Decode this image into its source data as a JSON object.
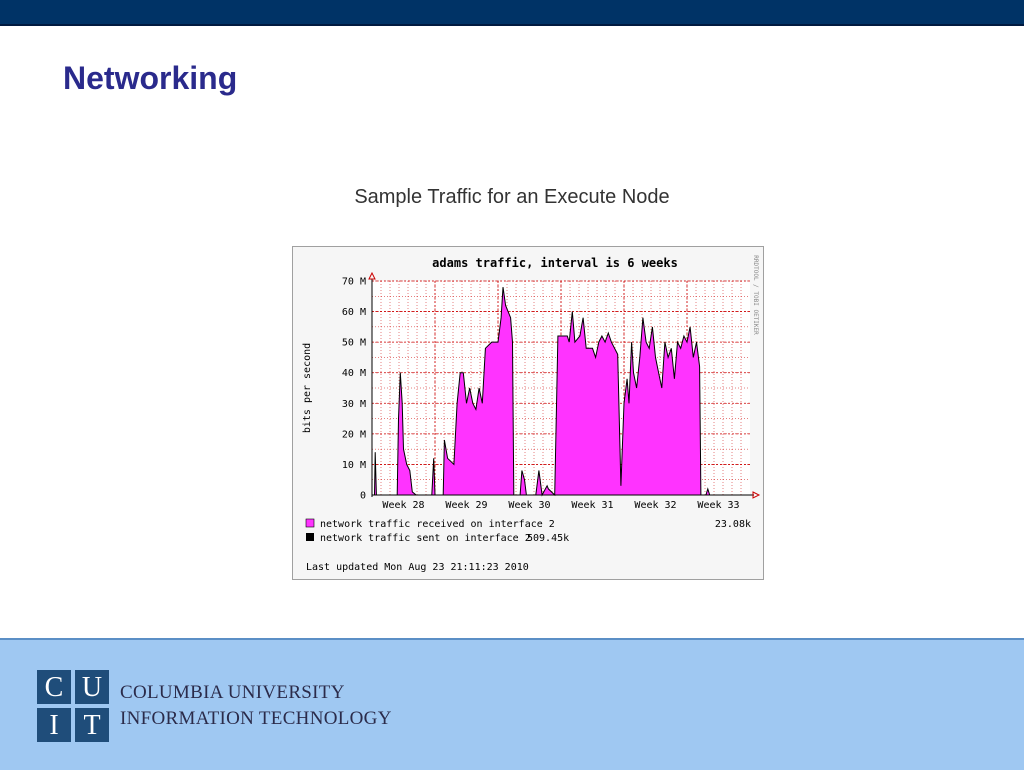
{
  "slide": {
    "title": "Networking",
    "caption": "Sample Traffic for an Execute Node"
  },
  "footer": {
    "logo_letters": [
      "C",
      "U",
      "I",
      "T"
    ],
    "org_line_1": "COLUMBIA UNIVERSITY",
    "org_line_2": "INFORMATION TECHNOLOGY"
  },
  "colors": {
    "top_bar": "#003366",
    "bottom_bar": "#9fc8f2",
    "title": "#2a2a8c",
    "received_fill": "#ff33ff",
    "sent_line": "#000000",
    "grid": "#cc0000",
    "logo": "#1f4d7a"
  },
  "chart_data": {
    "type": "area",
    "title": "adams traffic, interval is 6 weeks",
    "ylabel": "bits per second",
    "side_label": "RRDTOOL / TOBI OETIKER",
    "ylim": [
      0,
      70
    ],
    "y_unit": "M",
    "y_ticks": [
      "0",
      "10 M",
      "20 M",
      "30 M",
      "40 M",
      "50 M",
      "60 M",
      "70 M"
    ],
    "x_range": [
      0,
      6
    ],
    "x_ticks": [
      {
        "label": "Week 28",
        "x": 0.5
      },
      {
        "label": "Week 29",
        "x": 1.5
      },
      {
        "label": "Week 30",
        "x": 2.5
      },
      {
        "label": "Week 31",
        "x": 3.5
      },
      {
        "label": "Week 32",
        "x": 4.5
      },
      {
        "label": "Week 33",
        "x": 5.5
      }
    ],
    "grid": true,
    "legend_position": "bottom",
    "series": [
      {
        "name": "network traffic received on interface 2",
        "current": "23.08k",
        "color": "#ff33ff",
        "points": [
          [
            0,
            0
          ],
          [
            0.04,
            0
          ],
          [
            0.05,
            14
          ],
          [
            0.07,
            0
          ],
          [
            0.4,
            0
          ],
          [
            0.42,
            25
          ],
          [
            0.45,
            40
          ],
          [
            0.48,
            30
          ],
          [
            0.5,
            15
          ],
          [
            0.55,
            10
          ],
          [
            0.6,
            8
          ],
          [
            0.64,
            1
          ],
          [
            0.7,
            0
          ],
          [
            0.95,
            0
          ],
          [
            0.98,
            12
          ],
          [
            1.0,
            0
          ],
          [
            1.13,
            0
          ],
          [
            1.15,
            18
          ],
          [
            1.2,
            12
          ],
          [
            1.3,
            10
          ],
          [
            1.35,
            30
          ],
          [
            1.4,
            40
          ],
          [
            1.45,
            40
          ],
          [
            1.5,
            30
          ],
          [
            1.55,
            35
          ],
          [
            1.6,
            30
          ],
          [
            1.65,
            28
          ],
          [
            1.7,
            35
          ],
          [
            1.75,
            30
          ],
          [
            1.8,
            48
          ],
          [
            1.9,
            50
          ],
          [
            2.0,
            50
          ],
          [
            2.05,
            58
          ],
          [
            2.08,
            68
          ],
          [
            2.12,
            62
          ],
          [
            2.2,
            58
          ],
          [
            2.23,
            50
          ],
          [
            2.25,
            0
          ],
          [
            2.35,
            0
          ],
          [
            2.38,
            8
          ],
          [
            2.42,
            5
          ],
          [
            2.45,
            0
          ],
          [
            2.6,
            0
          ],
          [
            2.65,
            8
          ],
          [
            2.7,
            0
          ],
          [
            2.78,
            3
          ],
          [
            2.8,
            2
          ],
          [
            2.9,
            0
          ],
          [
            2.95,
            52
          ],
          [
            3.1,
            52
          ],
          [
            3.13,
            50
          ],
          [
            3.18,
            60
          ],
          [
            3.22,
            50
          ],
          [
            3.3,
            52
          ],
          [
            3.35,
            58
          ],
          [
            3.4,
            48
          ],
          [
            3.5,
            48
          ],
          [
            3.55,
            45
          ],
          [
            3.6,
            50
          ],
          [
            3.65,
            52
          ],
          [
            3.7,
            50
          ],
          [
            3.75,
            53
          ],
          [
            3.8,
            50
          ],
          [
            3.9,
            46
          ],
          [
            3.95,
            3
          ],
          [
            4.0,
            30
          ],
          [
            4.05,
            38
          ],
          [
            4.08,
            30
          ],
          [
            4.12,
            50
          ],
          [
            4.15,
            40
          ],
          [
            4.2,
            35
          ],
          [
            4.25,
            45
          ],
          [
            4.3,
            58
          ],
          [
            4.35,
            50
          ],
          [
            4.4,
            48
          ],
          [
            4.45,
            55
          ],
          [
            4.5,
            45
          ],
          [
            4.55,
            40
          ],
          [
            4.6,
            35
          ],
          [
            4.65,
            50
          ],
          [
            4.7,
            45
          ],
          [
            4.75,
            48
          ],
          [
            4.8,
            38
          ],
          [
            4.85,
            50
          ],
          [
            4.9,
            48
          ],
          [
            4.95,
            52
          ],
          [
            5.0,
            50
          ],
          [
            5.05,
            55
          ],
          [
            5.1,
            45
          ],
          [
            5.15,
            50
          ],
          [
            5.2,
            42
          ],
          [
            5.22,
            0
          ],
          [
            5.3,
            0
          ],
          [
            5.33,
            2
          ],
          [
            5.36,
            0
          ],
          [
            5.42,
            0
          ]
        ]
      },
      {
        "name": "network traffic sent on interface 2",
        "current": "509.45k",
        "color": "#000000",
        "points": [
          [
            0,
            0
          ],
          [
            0.04,
            0
          ],
          [
            0.05,
            14
          ],
          [
            0.07,
            0
          ],
          [
            0.4,
            0
          ],
          [
            0.42,
            25
          ],
          [
            0.45,
            40
          ],
          [
            0.48,
            30
          ],
          [
            0.5,
            15
          ],
          [
            0.55,
            10
          ],
          [
            0.6,
            8
          ],
          [
            0.64,
            1
          ],
          [
            0.7,
            0
          ],
          [
            0.95,
            0
          ],
          [
            0.98,
            12
          ],
          [
            1.0,
            0
          ],
          [
            1.13,
            0
          ],
          [
            1.15,
            18
          ],
          [
            1.2,
            12
          ],
          [
            1.3,
            10
          ],
          [
            1.35,
            30
          ],
          [
            1.4,
            40
          ],
          [
            1.45,
            40
          ],
          [
            1.5,
            30
          ],
          [
            1.55,
            35
          ],
          [
            1.6,
            30
          ],
          [
            1.65,
            28
          ],
          [
            1.7,
            35
          ],
          [
            1.75,
            30
          ],
          [
            1.8,
            48
          ],
          [
            1.9,
            50
          ],
          [
            2.0,
            50
          ],
          [
            2.05,
            58
          ],
          [
            2.08,
            68
          ],
          [
            2.12,
            62
          ],
          [
            2.2,
            58
          ],
          [
            2.23,
            50
          ],
          [
            2.25,
            0
          ],
          [
            2.35,
            0
          ],
          [
            2.38,
            8
          ],
          [
            2.42,
            5
          ],
          [
            2.45,
            0
          ],
          [
            2.6,
            0
          ],
          [
            2.65,
            8
          ],
          [
            2.7,
            0
          ],
          [
            2.78,
            3
          ],
          [
            2.8,
            2
          ],
          [
            2.9,
            0
          ],
          [
            2.95,
            52
          ],
          [
            3.1,
            52
          ],
          [
            3.13,
            50
          ],
          [
            3.18,
            60
          ],
          [
            3.22,
            50
          ],
          [
            3.3,
            52
          ],
          [
            3.35,
            58
          ],
          [
            3.4,
            48
          ],
          [
            3.5,
            48
          ],
          [
            3.55,
            45
          ],
          [
            3.6,
            50
          ],
          [
            3.65,
            52
          ],
          [
            3.7,
            50
          ],
          [
            3.75,
            53
          ],
          [
            3.8,
            50
          ],
          [
            3.9,
            46
          ],
          [
            3.95,
            3
          ],
          [
            4.0,
            30
          ],
          [
            4.05,
            38
          ],
          [
            4.08,
            30
          ],
          [
            4.12,
            50
          ],
          [
            4.15,
            40
          ],
          [
            4.2,
            35
          ],
          [
            4.25,
            45
          ],
          [
            4.3,
            58
          ],
          [
            4.35,
            50
          ],
          [
            4.4,
            48
          ],
          [
            4.45,
            55
          ],
          [
            4.5,
            45
          ],
          [
            4.55,
            40
          ],
          [
            4.6,
            35
          ],
          [
            4.65,
            50
          ],
          [
            4.7,
            45
          ],
          [
            4.75,
            48
          ],
          [
            4.8,
            38
          ],
          [
            4.85,
            50
          ],
          [
            4.9,
            48
          ],
          [
            4.95,
            52
          ],
          [
            5.0,
            50
          ],
          [
            5.05,
            55
          ],
          [
            5.1,
            45
          ],
          [
            5.15,
            50
          ],
          [
            5.2,
            42
          ],
          [
            5.22,
            0
          ],
          [
            5.3,
            0
          ],
          [
            5.33,
            2
          ],
          [
            5.36,
            0
          ],
          [
            5.42,
            0
          ]
        ]
      }
    ],
    "footer_text": "Last updated Mon Aug 23 21:11:23 2010"
  }
}
